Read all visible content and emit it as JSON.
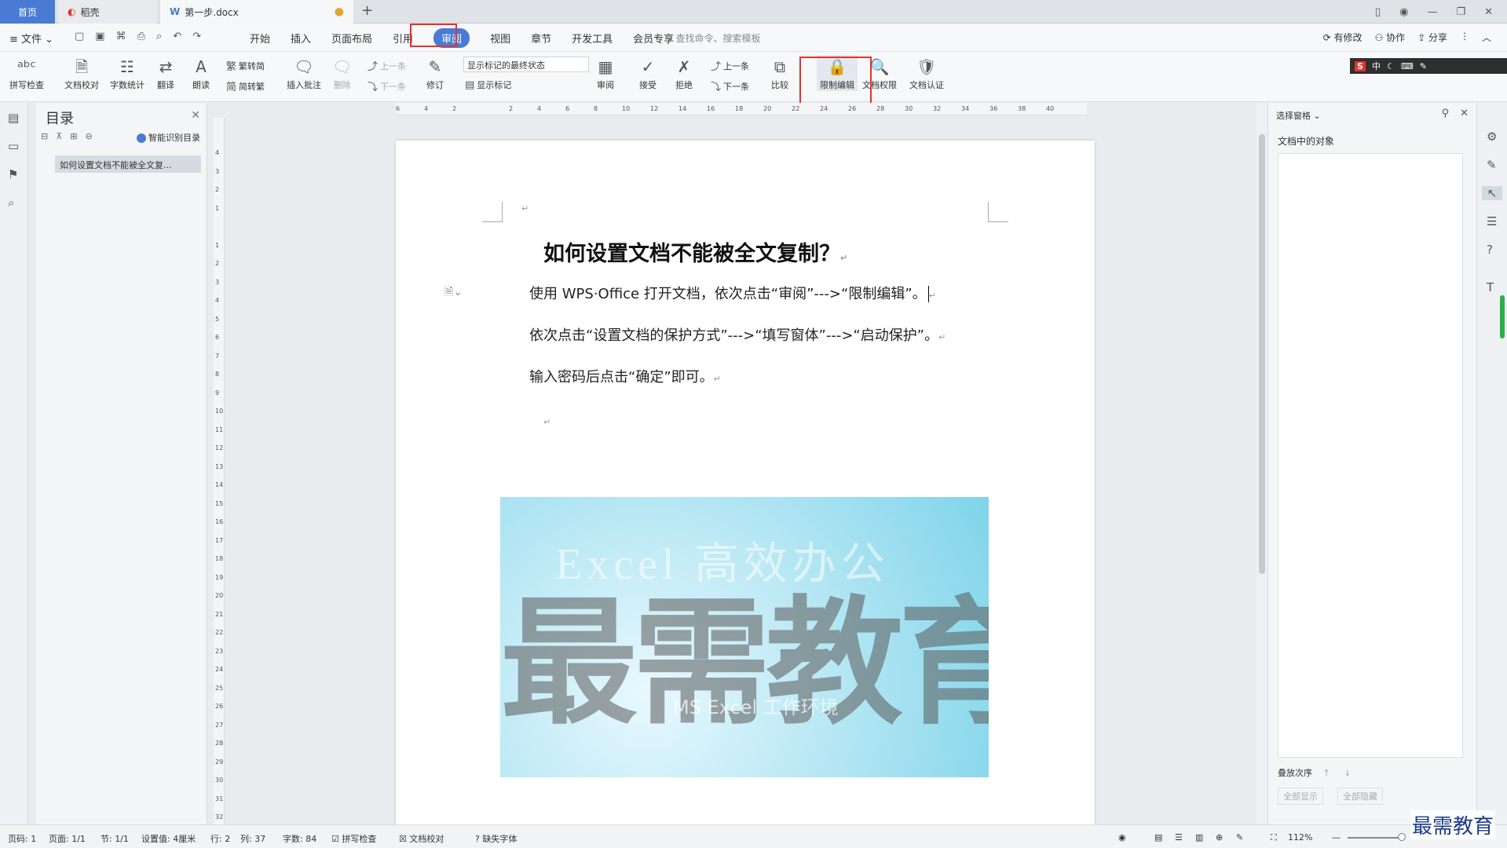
{
  "tabs": {
    "home": "首页",
    "daoke": "稻壳",
    "doc": "第一步.docx"
  },
  "menu": {
    "file": "文件",
    "tabs": [
      "开始",
      "插入",
      "页面布局",
      "引用",
      "审阅",
      "视图",
      "章节",
      "开发工具",
      "会员专享"
    ],
    "active": "审阅",
    "search": "查找命令、搜索模板",
    "right": [
      "有修改",
      "协作",
      "分享"
    ]
  },
  "ribbon": {
    "spell": "拼写检查",
    "proof": "文档校对",
    "count": "字数统计",
    "translate": "翻译",
    "read": "朗读",
    "t2s": "繁转简",
    "s2t": "简转繁",
    "insert_comment": "插入批注",
    "delete": "删除",
    "prev": "上一条",
    "next": "下一条",
    "revise": "修订",
    "markup_select": "显示标记的最终状态",
    "show_markup": "显示标记",
    "review": "审阅",
    "accept": "接受",
    "reject": "拒绝",
    "prev2": "上一条",
    "next2": "下一条",
    "compare": "比较",
    "restrict": "限制编辑",
    "perm": "文档权限",
    "cert": "文档认证"
  },
  "ime": {
    "s": "S",
    "text": "中"
  },
  "toc": {
    "title": "目录",
    "smart": "智能识别目录",
    "item": "如何设置文档不能被全文复..."
  },
  "doc": {
    "title": "如何设置文档不能被全文复制？",
    "p1": "使用 WPS·Office 打开文档，依次点击“审阅”--->“限制编辑”。",
    "p2": "依次点击“设置文档的保护方式”--->“填写窗体”--->“启动保护”。",
    "p3": "输入密码后点击“确定”即可。",
    "para_mark": "↵",
    "wm_en": "Excel 高效办公",
    "wm_cn": "最需教育",
    "wm_sub": "MS Excel 工作环境"
  },
  "panel": {
    "title": "选择窗格",
    "objects": "文档中的对象",
    "order": "叠放次序",
    "show_all": "全部显示",
    "hide_all": "全部隐藏"
  },
  "status": {
    "page": "页码: 1",
    "pages": "页面: 1/1",
    "section": "节: 1/1",
    "setting": "设置值: 4厘米",
    "row": "行: 2",
    "col": "列: 37",
    "words": "字数: 84",
    "spell": "拼写检查",
    "proof": "文档校对",
    "font": "缺失字体",
    "zoom": "112%"
  },
  "brand": "最需教育",
  "ruler_h": [
    "6",
    "4",
    "2",
    "",
    "2",
    "4",
    "6",
    "8",
    "10",
    "12",
    "14",
    "16",
    "18",
    "20",
    "22",
    "24",
    "26",
    "28",
    "30",
    "32",
    "34",
    "36",
    "38",
    "40"
  ],
  "ruler_v": [
    "4",
    "3",
    "2",
    "1",
    "",
    "1",
    "2",
    "3",
    "4",
    "5",
    "6",
    "7",
    "8",
    "9",
    "10",
    "11",
    "12",
    "13",
    "14",
    "15",
    "16",
    "17",
    "18",
    "19",
    "20",
    "21",
    "22",
    "23",
    "24",
    "25",
    "26",
    "27",
    "28",
    "29",
    "30",
    "31",
    "32"
  ]
}
